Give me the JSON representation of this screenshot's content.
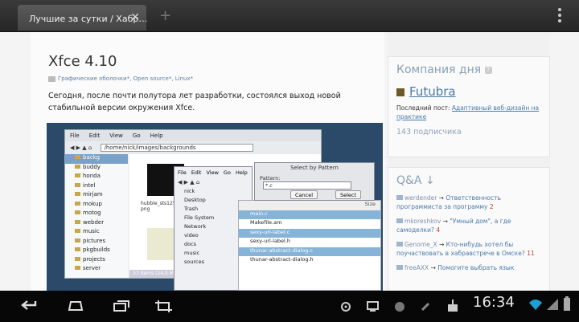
{
  "browser": {
    "tab_title": "Лучшие за сутки / Хабр…",
    "tab_close": "✕",
    "new_tab": "+"
  },
  "article": {
    "title": "Xfce 4.10",
    "hubs": "Графические оболочки*, Open source*, Linux*",
    "lead": "Сегодня, после почти полутора лет разработки, состоялся выход новой стабильной версии окружения Xfce.",
    "screenshot": {
      "menu": [
        "File",
        "Edit",
        "View",
        "Go",
        "Help"
      ],
      "path": "/home/nick/images/backgrounds",
      "side_items": [
        "backg",
        "buddy",
        "honda",
        "intel",
        "mirjam",
        "mokup",
        "motog",
        "webder",
        "music",
        "pictures",
        "pkgbuilds",
        "projects",
        "server"
      ],
      "thumb_label": "hubble_sts125_... png",
      "status": "37 items (24.0 MB",
      "dialog2_menu": [
        "File",
        "Edit",
        "View",
        "Go",
        "Help"
      ],
      "dialog2_list": [
        "nick",
        "Desktop",
        "Trash",
        "File System",
        "Network",
        "video",
        "docs",
        "music",
        "sources"
      ],
      "files_header": "Size",
      "files": [
        "main.c",
        "Makefile.am",
        "sexy-url-label.c",
        "sexy-url-label.h",
        "thunar-abstract-dialog.c",
        "thunar-abstract-dialog.h"
      ],
      "select_dialog": {
        "title": "Select by Pattern",
        "pattern_label": "Pattern:",
        "pattern_value": "*.c",
        "cancel": "Cancel",
        "select": "Select"
      }
    }
  },
  "sidebar": {
    "company_header": "Компания дня",
    "company_name": "Futubra",
    "last_post_label": "Последний пост:",
    "last_post_title": "Адаптивный веб-дизайн на практике",
    "subscribers": "143 подписчика",
    "qa_header": "Q&A ↓",
    "qa": [
      {
        "user": "werdender",
        "title": "Ответственность программиста за программу",
        "count": "2"
      },
      {
        "user": "mkoreshkov",
        "title": "\"Умный дом\", а где самоделки?",
        "count": "4"
      },
      {
        "user": "Genome_X",
        "title": "Кто-нибудь хотел бы поучаствовать в хабравстрече в Омске?",
        "count": "11"
      },
      {
        "user": "freeAXX",
        "title": "Помогите выбрать язык",
        "count": ""
      }
    ]
  },
  "system": {
    "clock": "16:34"
  }
}
